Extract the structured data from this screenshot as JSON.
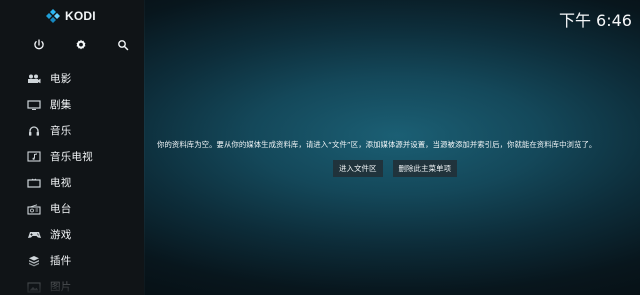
{
  "app": {
    "name": "KODI",
    "time": "下午 6:46"
  },
  "top_actions": [
    {
      "name": "power-icon"
    },
    {
      "name": "gear-icon"
    },
    {
      "name": "search-icon"
    }
  ],
  "sidebar": {
    "items": [
      {
        "label": "电影",
        "icon": "movie-icon"
      },
      {
        "label": "剧集",
        "icon": "tv-show-icon"
      },
      {
        "label": "音乐",
        "icon": "headphones-icon"
      },
      {
        "label": "音乐电视",
        "icon": "music-video-icon"
      },
      {
        "label": "电视",
        "icon": "tv-icon"
      },
      {
        "label": "电台",
        "icon": "radio-icon"
      },
      {
        "label": "游戏",
        "icon": "gamepad-icon"
      },
      {
        "label": "插件",
        "icon": "addon-icon"
      },
      {
        "label": "图片",
        "icon": "picture-icon"
      }
    ]
  },
  "main": {
    "message": "你的资料库为空。要从你的媒体生成资料库，请进入“文件”区，添加媒体源并设置，当源被添加并索引后，你就能在资料库中浏览了。",
    "buttons": {
      "enter_files": "进入文件区",
      "remove_main_menu": "删除此主菜单项"
    }
  }
}
